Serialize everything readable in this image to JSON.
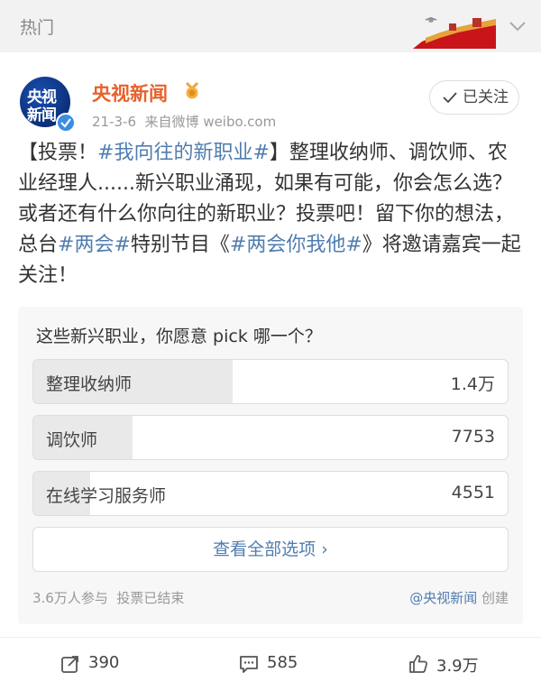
{
  "topbar": {
    "label": "热门"
  },
  "post": {
    "author": "央视新闻",
    "avatar_line1": "央视",
    "avatar_line2": "新闻",
    "date": "21-3-6",
    "source": "来自微博 weibo.com",
    "follow_label": "已关注",
    "text_segments": [
      {
        "t": "【投票！",
        "tag": false
      },
      {
        "t": "#我向往的新职业#",
        "tag": true
      },
      {
        "t": "】整理收纳师、调饮师、农业经理人......新兴职业涌现，如果有可能，你会怎么选？或者还有什么你向往的新职业？投票吧！留下你的想法，总台",
        "tag": false
      },
      {
        "t": "#两会#",
        "tag": true
      },
      {
        "t": "特别节目《",
        "tag": false
      },
      {
        "t": "#两会你我他#",
        "tag": true
      },
      {
        "t": "》将邀请嘉宾一起关注！",
        "tag": false
      }
    ]
  },
  "poll": {
    "question": "这些新兴职业，你愿意 pick 哪一个？",
    "options": [
      {
        "label": "整理收纳师",
        "count": "1.4万",
        "share": 0.42
      },
      {
        "label": "调饮师",
        "count": "7753",
        "share": 0.21
      },
      {
        "label": "在线学习服务师",
        "count": "4551",
        "share": 0.12
      }
    ],
    "view_all": "查看全部选项 ›",
    "participants": "3.6万人参与",
    "status": "投票已结束",
    "creator": "@央视新闻",
    "created": "创建"
  },
  "actions": {
    "repost": "390",
    "comment": "585",
    "like": "3.9万"
  },
  "colors": {
    "author": "#e8612c",
    "link": "#507daf"
  },
  "icons": [
    "chevron-down-icon",
    "great-wall-banner-icon",
    "medal-icon",
    "check-icon",
    "repost-icon",
    "comment-icon",
    "like-icon",
    "verified-badge-icon"
  ]
}
